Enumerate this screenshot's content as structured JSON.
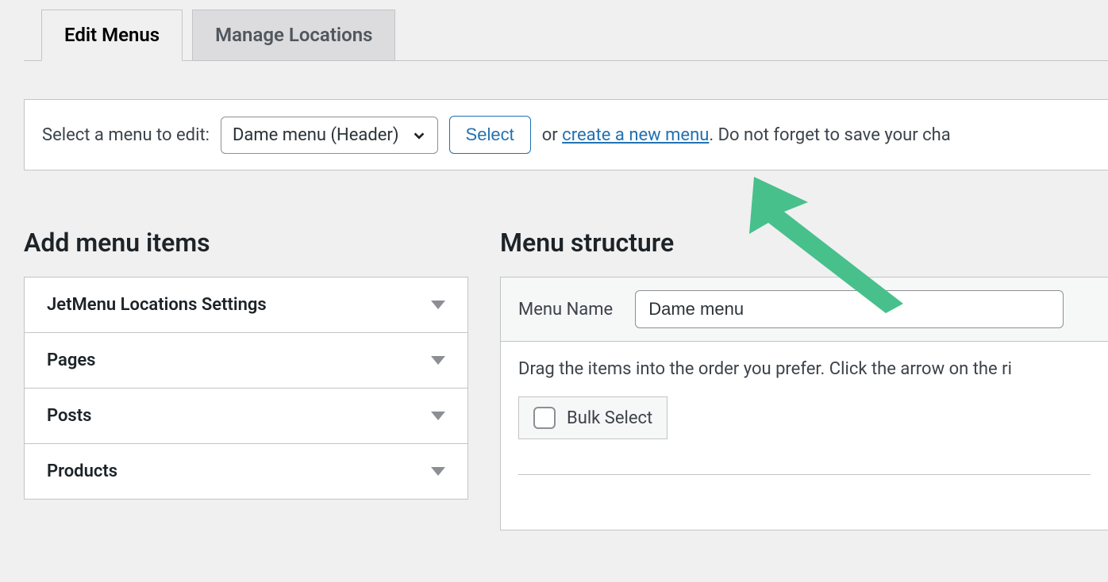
{
  "tabs": {
    "edit": "Edit Menus",
    "manage": "Manage Locations"
  },
  "selector": {
    "label": "Select a menu to edit:",
    "selected": "Dame menu (Header)",
    "select_btn": "Select",
    "or": "or",
    "create_link": "create a new menu",
    "tail": ". Do not forget to save your cha"
  },
  "left": {
    "heading": "Add menu items",
    "items": [
      "JetMenu Locations Settings",
      "Pages",
      "Posts",
      "Products"
    ]
  },
  "right": {
    "heading": "Menu structure",
    "name_label": "Menu Name",
    "name_value": "Dame menu",
    "instruction": "Drag the items into the order you prefer. Click the arrow on the ri",
    "bulk_select": "Bulk Select"
  }
}
